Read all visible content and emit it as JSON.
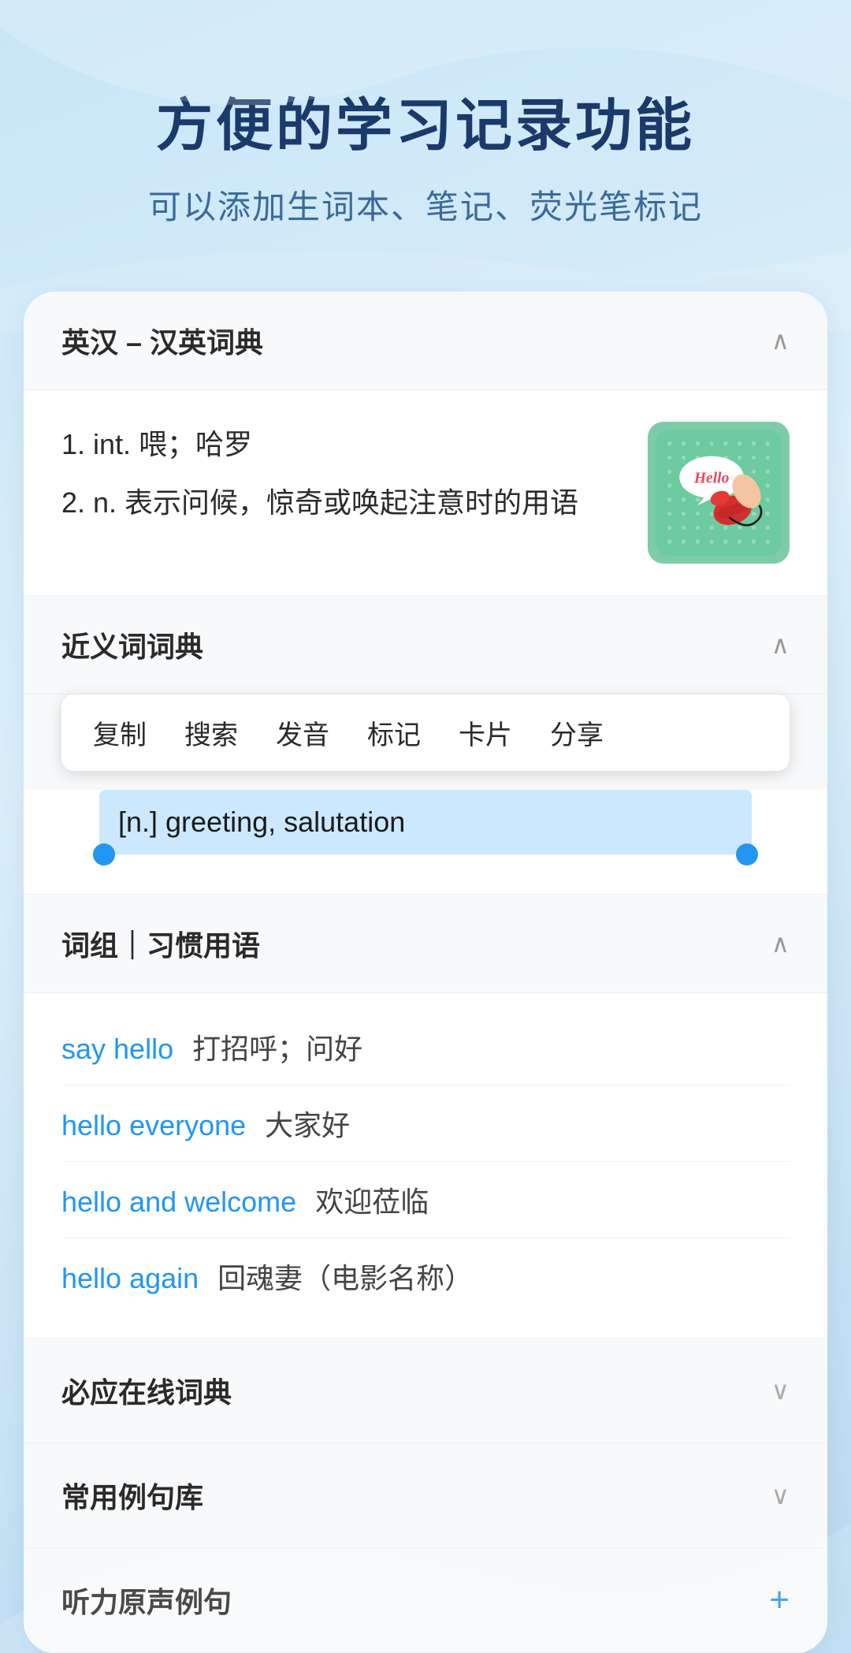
{
  "header": {
    "title": "方便的学习记录功能",
    "subtitle": "可以添加生词本、笔记、荧光笔标记"
  },
  "dictionary_section": {
    "label": "英汉 – 汉英词典",
    "chevron": "∧",
    "definition_1": "1. int. 喂；哈罗",
    "definition_2": "2. n. 表示问候，惊奇或唤起注意时的用语"
  },
  "synonyms_section": {
    "label": "近义词词典",
    "chevron": "∧",
    "context_menu": {
      "items": [
        "复制",
        "搜索",
        "发音",
        "标记",
        "卡片",
        "分享"
      ]
    },
    "selected_text": "[n.] greeting, salutation"
  },
  "phrases_section": {
    "label": "词组｜习惯用语",
    "chevron": "∧",
    "items": [
      {
        "en": "say hello",
        "zh": "打招呼；问好"
      },
      {
        "en": "hello everyone",
        "zh": "大家好"
      },
      {
        "en": "hello and welcome",
        "zh": "欢迎莅临"
      },
      {
        "en": "hello again",
        "zh": "回魂妻（电影名称）"
      }
    ]
  },
  "bottom_sections": [
    {
      "label": "必应在线词典",
      "icon": "chevron-down",
      "plus": false
    },
    {
      "label": "常用例句库",
      "icon": "chevron-down",
      "plus": false
    },
    {
      "label": "听力原声例句",
      "icon": "plus",
      "plus": true
    }
  ]
}
